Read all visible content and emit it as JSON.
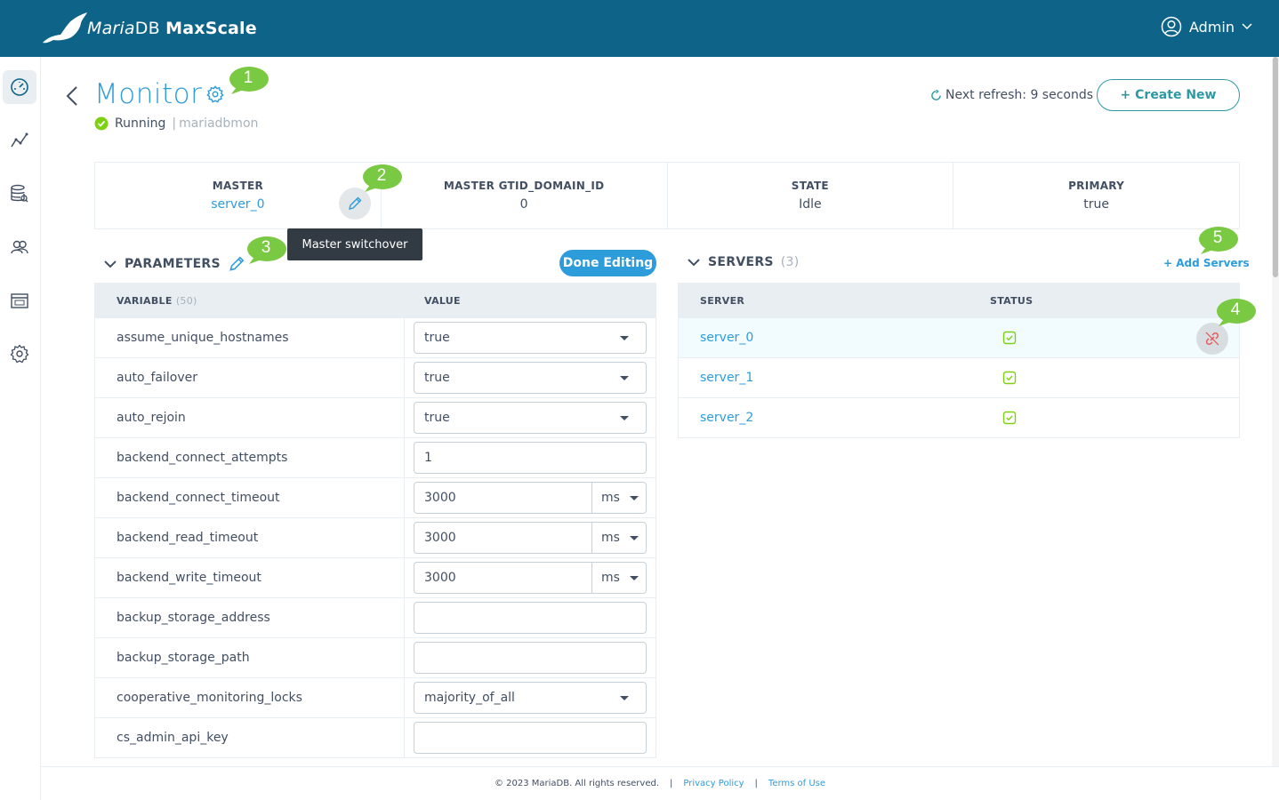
{
  "header": {
    "brand_a": "Maria",
    "brand_b": "DB",
    "brand_c": "MaxScale",
    "user": "Admin"
  },
  "page": {
    "title": "Monitor",
    "status": "Running",
    "separator": "|",
    "module": "mariadbmon",
    "refresh": "Next refresh: 9 seconds",
    "create_label": "+ Create New"
  },
  "summary": [
    {
      "label": "MASTER",
      "value": "server_0"
    },
    {
      "label": "MASTER GTID_DOMAIN_ID",
      "value": "0"
    },
    {
      "label": "STATE",
      "value": "Idle"
    },
    {
      "label": "PRIMARY",
      "value": "true"
    }
  ],
  "tooltip": "Master switchover",
  "parameters": {
    "title": "PARAMETERS",
    "done_label": "Done Editing",
    "col_variable": "VARIABLE",
    "col_count": "(50)",
    "col_value": "VALUE",
    "rows": [
      {
        "name": "assume_unique_hostnames",
        "value": "true",
        "kind": "select"
      },
      {
        "name": "auto_failover",
        "value": "true",
        "kind": "select"
      },
      {
        "name": "auto_rejoin",
        "value": "true",
        "kind": "select"
      },
      {
        "name": "backend_connect_attempts",
        "value": "1",
        "kind": "text"
      },
      {
        "name": "backend_connect_timeout",
        "value": "3000",
        "unit": "ms",
        "kind": "duration"
      },
      {
        "name": "backend_read_timeout",
        "value": "3000",
        "unit": "ms",
        "kind": "duration"
      },
      {
        "name": "backend_write_timeout",
        "value": "3000",
        "unit": "ms",
        "kind": "duration"
      },
      {
        "name": "backup_storage_address",
        "value": "",
        "kind": "text"
      },
      {
        "name": "backup_storage_path",
        "value": "",
        "kind": "text"
      },
      {
        "name": "cooperative_monitoring_locks",
        "value": "majority_of_all",
        "kind": "select"
      },
      {
        "name": "cs_admin_api_key",
        "value": "",
        "kind": "text"
      }
    ]
  },
  "servers": {
    "title": "SERVERS",
    "count": "(3)",
    "add_label": "+ Add Servers",
    "col_server": "SERVER",
    "col_status": "STATUS",
    "rows": [
      {
        "name": "server_0"
      },
      {
        "name": "server_1"
      },
      {
        "name": "server_2"
      }
    ]
  },
  "callouts": [
    "1",
    "2",
    "3",
    "4",
    "5"
  ],
  "footer": {
    "copyright": "© 2023 MariaDB. All rights reserved.",
    "sep": "|",
    "privacy": "Privacy Policy",
    "terms": "Terms of Use"
  },
  "colors": {
    "header": "#0e6488",
    "accent": "#2d9cdb",
    "callout": "#7ac943",
    "running": "#7dd012"
  },
  "icons": [
    "seal-logo",
    "user-circle-icon",
    "dashboard-icon",
    "graph-icon",
    "database-icon",
    "users-icon",
    "logs-icon",
    "settings-icon",
    "gear-icon",
    "pencil-icon",
    "refresh-icon",
    "chevron-down-icon",
    "status-ok-icon",
    "unlink-icon"
  ]
}
